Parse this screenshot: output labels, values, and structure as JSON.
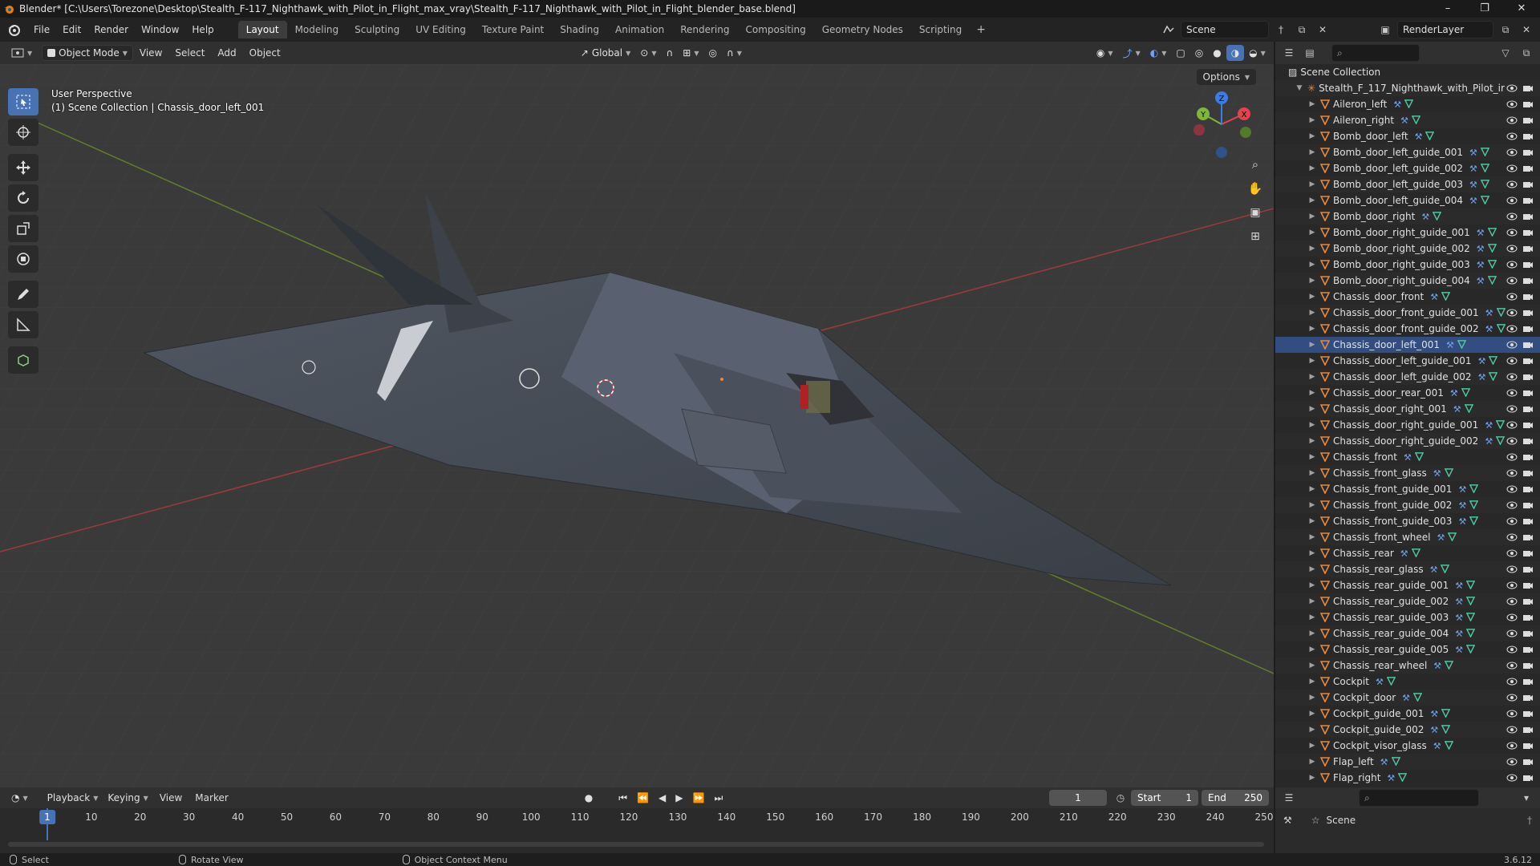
{
  "window": {
    "title": "Blender* [C:\\Users\\Torezone\\Desktop\\Stealth_F-117_Nighthawk_with_Pilot_in_Flight_max_vray\\Stealth_F-117_Nighthawk_with_Pilot_in_Flight_blender_base.blend]",
    "minimize": "–",
    "maximize": "❐",
    "close": "✕"
  },
  "menus": [
    "File",
    "Edit",
    "Render",
    "Window",
    "Help"
  ],
  "workspaces": [
    "Layout",
    "Modeling",
    "Sculpting",
    "UV Editing",
    "Texture Paint",
    "Shading",
    "Animation",
    "Rendering",
    "Compositing",
    "Geometry Nodes",
    "Scripting"
  ],
  "active_workspace": "Layout",
  "scene_name": "Scene",
  "view_layer": "RenderLayer",
  "viewport_header": {
    "mode": "Object Mode",
    "menus": [
      "View",
      "Select",
      "Add",
      "Object"
    ],
    "transform_orientation": "Global",
    "options_label": "Options"
  },
  "viewport": {
    "perspective_label": "User Perspective",
    "context_label": "(1) Scene Collection | Chassis_door_left_001",
    "gizmo_axes": [
      "X",
      "Y",
      "Z"
    ]
  },
  "outliner": {
    "root": "Scene Collection",
    "collection": "Stealth_F_117_Nighthawk_with_Pilot_ir",
    "items": [
      "Aileron_left",
      "Aileron_right",
      "Bomb_door_left",
      "Bomb_door_left_guide_001",
      "Bomb_door_left_guide_002",
      "Bomb_door_left_guide_003",
      "Bomb_door_left_guide_004",
      "Bomb_door_right",
      "Bomb_door_right_guide_001",
      "Bomb_door_right_guide_002",
      "Bomb_door_right_guide_003",
      "Bomb_door_right_guide_004",
      "Chassis_door_front",
      "Chassis_door_front_guide_001",
      "Chassis_door_front_guide_002",
      "Chassis_door_left_001",
      "Chassis_door_left_guide_001",
      "Chassis_door_left_guide_002",
      "Chassis_door_rear_001",
      "Chassis_door_right_001",
      "Chassis_door_right_guide_001",
      "Chassis_door_right_guide_002",
      "Chassis_front",
      "Chassis_front_glass",
      "Chassis_front_guide_001",
      "Chassis_front_guide_002",
      "Chassis_front_guide_003",
      "Chassis_front_wheel",
      "Chassis_rear",
      "Chassis_rear_glass",
      "Chassis_rear_guide_001",
      "Chassis_rear_guide_002",
      "Chassis_rear_guide_003",
      "Chassis_rear_guide_004",
      "Chassis_rear_guide_005",
      "Chassis_rear_wheel",
      "Cockpit",
      "Cockpit_door",
      "Cockpit_guide_001",
      "Cockpit_guide_002",
      "Cockpit_visor_glass",
      "Flap_left",
      "Flap_right"
    ],
    "selected": "Chassis_door_left_001"
  },
  "timeline": {
    "menus": [
      "Playback",
      "Keying",
      "View",
      "Marker"
    ],
    "current_frame": "1",
    "start_label": "Start",
    "start_value": "1",
    "end_label": "End",
    "end_value": "250",
    "ruler": [
      10,
      20,
      30,
      40,
      50,
      60,
      70,
      80,
      90,
      100,
      110,
      120,
      130,
      140,
      150,
      160,
      170,
      180,
      190,
      200,
      210,
      220,
      230,
      240,
      250
    ]
  },
  "properties": {
    "scene_label": "Scene"
  },
  "status": {
    "select": "Select",
    "rotate": "Rotate View",
    "context_menu": "Object Context Menu",
    "version": "3.6.12"
  },
  "colors": {
    "accent": "#4772b3",
    "object_orange": "#e8883a",
    "axis_x": "#e04450",
    "axis_y": "#7fb63a",
    "axis_z": "#3b7de0"
  }
}
